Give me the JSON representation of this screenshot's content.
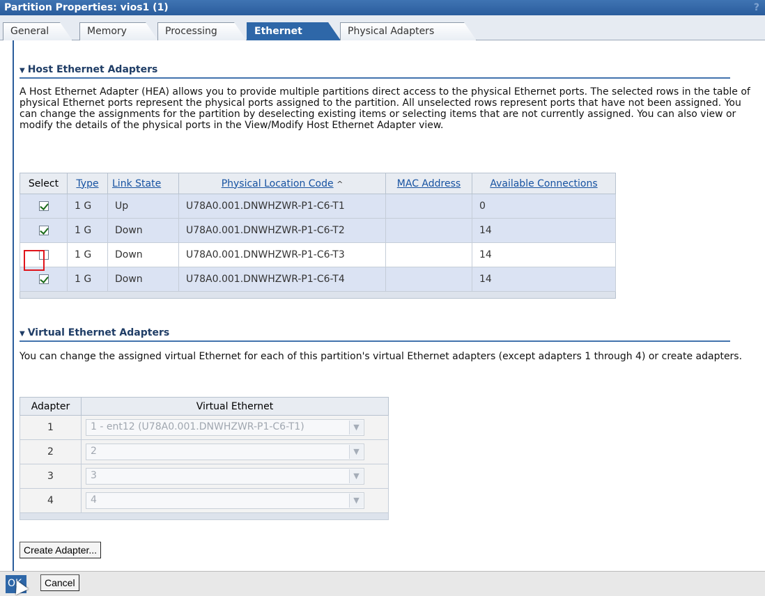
{
  "window": {
    "title": "Partition Properties: vios1 (1)",
    "help_glyph": "?"
  },
  "tabs": [
    {
      "label": "General",
      "active": false
    },
    {
      "label": "Memory",
      "active": false
    },
    {
      "label": "Processing",
      "active": false
    },
    {
      "label": "Ethernet",
      "active": true
    },
    {
      "label": "Physical Adapters",
      "active": false
    }
  ],
  "hea": {
    "heading": "Host Ethernet Adapters",
    "description": "A Host Ethernet Adapter (HEA) allows you to provide multiple partitions direct access to the physical Ethernet ports. The selected rows in the table of physical Ethernet ports represent the physical ports assigned to the partition. All unselected rows represent ports that have not been assigned. You can change the assignments for the partition by deselecting existing items or selecting items that are not currently assigned. You can also view or modify the details of the physical ports in the View/Modify Host Ethernet Adapter view.",
    "columns": {
      "select": "Select",
      "type": "Type",
      "link_state": "Link State",
      "location": "Physical Location Code",
      "sort_glyph": "^",
      "mac": "MAC Address",
      "connections": "Available Connections"
    },
    "rows": [
      {
        "selected": true,
        "type": "1 G",
        "link_state": "Up",
        "location": "U78A0.001.DNWHZWR-P1-C6-T1",
        "mac": "",
        "connections": "0"
      },
      {
        "selected": true,
        "type": "1 G",
        "link_state": "Down",
        "location": "U78A0.001.DNWHZWR-P1-C6-T2",
        "mac": "",
        "connections": "14"
      },
      {
        "selected": false,
        "type": "1 G",
        "link_state": "Down",
        "location": "U78A0.001.DNWHZWR-P1-C6-T3",
        "mac": "",
        "connections": "14"
      },
      {
        "selected": true,
        "type": "1 G",
        "link_state": "Down",
        "location": "U78A0.001.DNWHZWR-P1-C6-T4",
        "mac": "",
        "connections": "14"
      }
    ]
  },
  "vea": {
    "heading": "Virtual Ethernet Adapters",
    "description": "You can change the assigned virtual Ethernet for each of this partition's virtual Ethernet adapters (except adapters 1 through 4) or create adapters.",
    "columns": {
      "adapter": "Adapter",
      "virtual_ethernet": "Virtual Ethernet"
    },
    "rows": [
      {
        "adapter": "1",
        "value": "1 - ent12 (U78A0.001.DNWHZWR-P1-C6-T1)"
      },
      {
        "adapter": "2",
        "value": "2"
      },
      {
        "adapter": "3",
        "value": "3"
      },
      {
        "adapter": "4",
        "value": "4"
      }
    ],
    "create_button": "Create Adapter..."
  },
  "footer": {
    "ok_label": "OK",
    "cancel_label": "Cancel"
  }
}
